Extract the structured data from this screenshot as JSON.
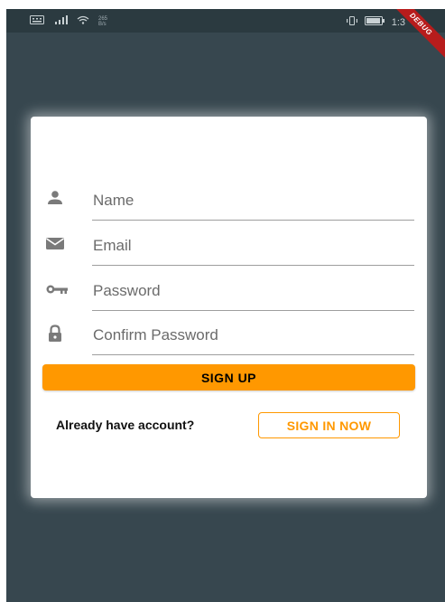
{
  "status_bar": {
    "speed_value": "265",
    "speed_unit": "B/s",
    "time": "1:3"
  },
  "debug_banner": "DEBUG",
  "form": {
    "fields": [
      {
        "placeholder": "Name",
        "icon": "person-icon"
      },
      {
        "placeholder": "Email",
        "icon": "mail-icon"
      },
      {
        "placeholder": "Password",
        "icon": "key-icon"
      },
      {
        "placeholder": "Confirm Password",
        "icon": "lock-icon"
      }
    ],
    "signup_label": "SIGN UP",
    "already_text": "Already have account?",
    "signin_label": "SIGN IN NOW"
  },
  "colors": {
    "background": "#37474f",
    "accent": "#ff9800",
    "icon": "#7a7a7a"
  }
}
